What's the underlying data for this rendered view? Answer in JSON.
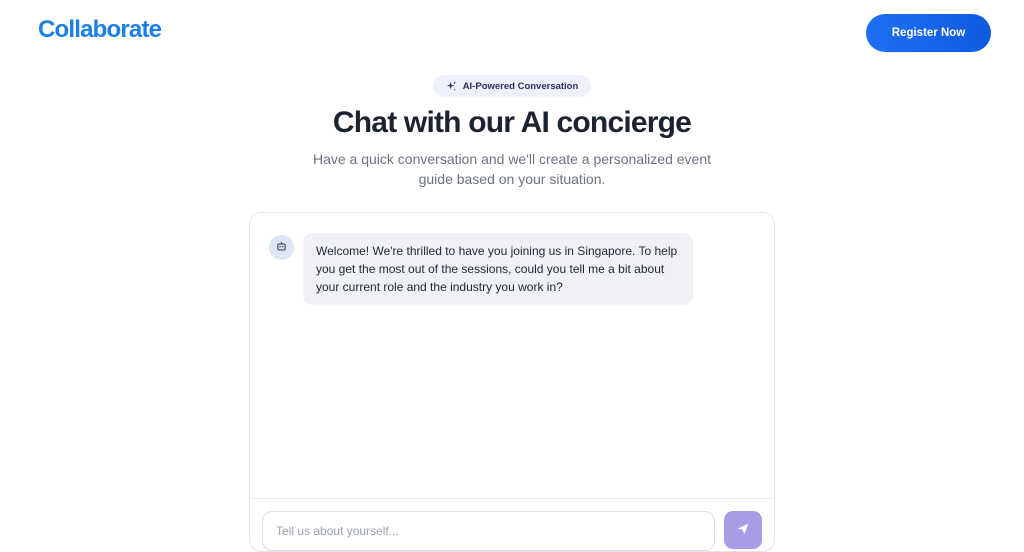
{
  "header": {
    "logo": "Collaborate",
    "register_label": "Register Now"
  },
  "hero": {
    "pill_label": "AI-Powered Conversation",
    "title": "Chat with our AI concierge",
    "subtitle": "Have a quick conversation and we'll create a personalized event guide based on your situation."
  },
  "chat": {
    "messages": [
      {
        "sender": "bot",
        "text": "Welcome! We're thrilled to have you joining us in Singapore. To help you get the most out of the sessions, could you tell me a bit about your current role and the industry you work in?"
      }
    ],
    "input_placeholder": "Tell us about yourself...",
    "input_value": ""
  },
  "icons": {
    "pill_icon": "sparkle-icon",
    "avatar_icon": "robot-icon",
    "send_icon": "send-icon"
  },
  "colors": {
    "brand": "#1a7fe6",
    "primary_button": "#1f6ff3",
    "send_button": "#a99be6",
    "bubble_bg": "#f0f1f5"
  }
}
